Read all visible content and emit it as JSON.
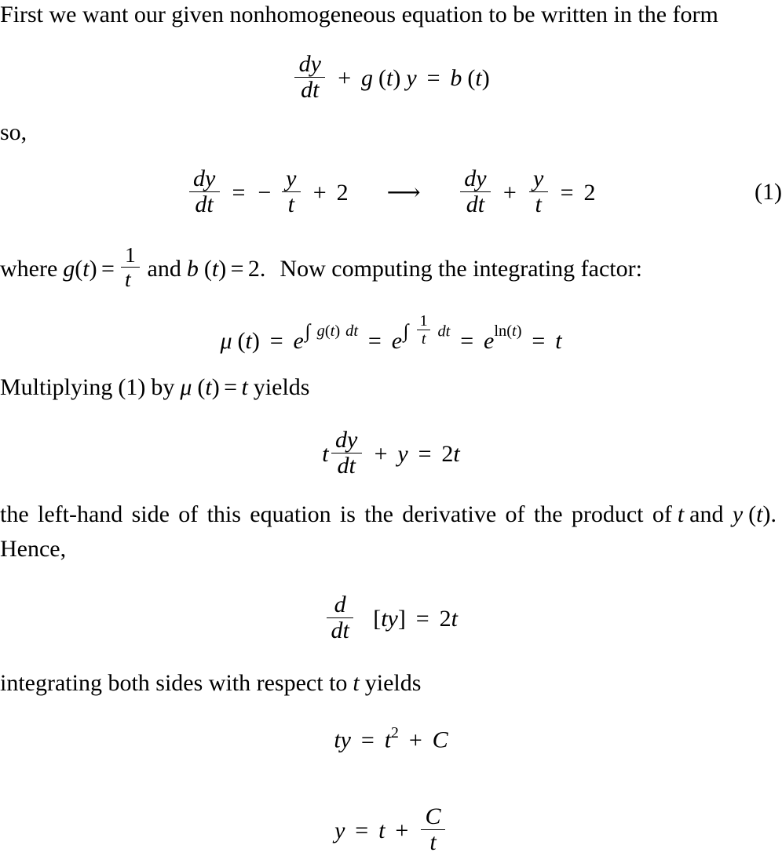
{
  "document": {
    "type": "math-worked-solution",
    "topic": "first-order linear nonhomogeneous ODE via integrating factor",
    "background_color": "#ffffff",
    "text_color": "#000000"
  },
  "text": {
    "intro": "First we want our given nonhomogeneous equation to be written in the form",
    "so": "so,",
    "where_prefix": "where",
    "where_mid": "and",
    "where_suffix": "Now computing the integrating factor:",
    "multiplying_prefix": "Multiplying",
    "multiplying_mid": "by",
    "multiplying_suffix": "yields",
    "lhs_sentence": "the left-hand side of this equation is the derivative of the product of",
    "lhs_sentence_and": "and",
    "hence": "Hence,",
    "integrating": "integrating both sides with respect to",
    "integrating_suffix": "yields"
  },
  "symbols": {
    "d": "d",
    "t": "t",
    "y": "y",
    "g": "g",
    "b": "b",
    "C": "C",
    "mu": "μ",
    "e": "e",
    "ln": "ln",
    "integral": "∫",
    "equals": "=",
    "plus": "+",
    "minus": "−",
    "arrow": "⟶",
    "open_paren": "(",
    "close_paren": ")",
    "open_bracket": "[",
    "close_bracket": "]",
    "period": ".",
    "one": "1",
    "two": "2",
    "two_exp": "2",
    "dt": "dt"
  },
  "equations": {
    "general_form": {
      "id": "eq-general-form",
      "latex": "\\frac{dy}{dt} + g(t)\\,y = b(t)",
      "plain": "dy/dt + g(t) y = b(t)",
      "tag": null
    },
    "equation_one": {
      "id": "eq-1",
      "latex": "\\frac{dy}{dt} = -\\frac{y}{t} + 2 \\quad \\longrightarrow \\quad \\frac{dy}{dt} + \\frac{y}{t} = 2",
      "plain": "dy/dt = -y/t + 2  ->  dy/dt + y/t = 2",
      "tag": "(1)"
    },
    "integrating_factor": {
      "id": "eq-mu",
      "latex": "\\mu(t) = e^{\\int g(t)\\,dt} = e^{\\int \\frac{1}{t}\\,dt} = e^{\\ln(t)} = t",
      "plain": "mu(t) = e^(int g(t) dt) = e^(int 1/t dt) = e^ln(t) = t",
      "tag": null
    },
    "multiplied": {
      "id": "eq-multiplied",
      "latex": "t\\frac{dy}{dt} + y = 2t",
      "plain": "t dy/dt + y = 2t",
      "tag": null
    },
    "derivative_product": {
      "id": "eq-derivative-product",
      "latex": "\\frac{d}{dt}\\left[ty\\right] = 2t",
      "plain": "d/dt [ty] = 2t",
      "tag": null
    },
    "integrated": {
      "id": "eq-integrated",
      "latex": "ty = t^{2} + C",
      "plain": "ty = t^2 + C",
      "tag": null
    },
    "solution": {
      "id": "eq-solution",
      "latex": "y = t + \\frac{C}{t}",
      "plain": "y = t + C/t",
      "tag": null
    }
  },
  "inline_math": {
    "g_of_t_equals_one_over_t": "g(t) = 1/t",
    "b_of_t_equals_two": "b(t) = 2.",
    "reference_one": "(1)",
    "mu_of_t_equals_t": "μ(t) = t",
    "t": "t",
    "y_of_t": "y(t)."
  }
}
